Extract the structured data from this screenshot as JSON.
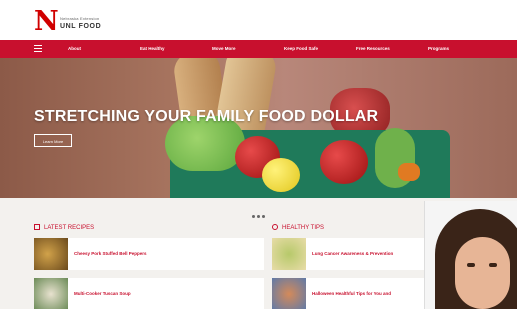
{
  "header": {
    "logo_letter": "N",
    "logo_sub": "Nebraska Extension",
    "logo_title": "UNL FOOD"
  },
  "nav": {
    "items": [
      "About",
      "Eat Healthy",
      "Move More",
      "Keep Food Safe",
      "Free Resources",
      "Programs"
    ]
  },
  "hero": {
    "title": "STRETCHING YOUR FAMILY FOOD DOLLAR",
    "button": "Learn More",
    "slides": 3
  },
  "sections": {
    "recipes": {
      "heading": "LATEST RECIPES",
      "items": [
        "Cheesy Pork Stuffed Bell Peppers",
        "Multi-Cooker Tuscan Soup"
      ]
    },
    "tips": {
      "heading": "HEALTHY TIPS",
      "items": [
        "Lung Cancer Awareness & Prevention",
        "Halloween Healthful Tips for You and"
      ]
    }
  },
  "colors": {
    "brand_red": "#c8102e",
    "nav_text": "#ffffff"
  }
}
